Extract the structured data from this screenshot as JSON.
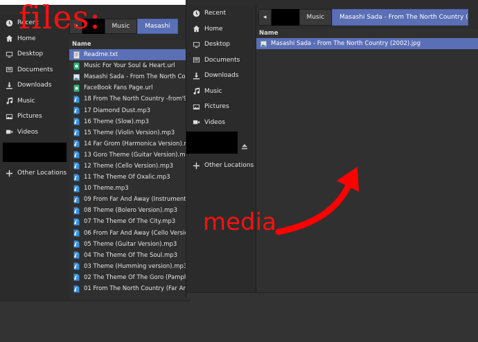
{
  "annotation": {
    "files_label": "files:",
    "media_label": "media",
    "arrow_color": "#ff0000"
  },
  "files_window": {
    "sidebar": [
      {
        "label": "Recent",
        "icon": "clock-icon"
      },
      {
        "label": "Home",
        "icon": "home-icon"
      },
      {
        "label": "Desktop",
        "icon": "desktop-icon"
      },
      {
        "label": "Documents",
        "icon": "documents-icon"
      },
      {
        "label": "Downloads",
        "icon": "downloads-icon"
      },
      {
        "label": "Music",
        "icon": "music-icon"
      },
      {
        "label": "Pictures",
        "icon": "pictures-icon"
      },
      {
        "label": "Videos",
        "icon": "videos-icon"
      },
      {
        "label": "Other Locations",
        "icon": "plus-icon"
      }
    ],
    "pathbar": [
      "Music",
      "Masashi"
    ],
    "column_header": "Name",
    "files": [
      {
        "name": "Readme.txt",
        "type": "text",
        "selected": true
      },
      {
        "name": "Music For Your Soul & Heart.url",
        "type": "url"
      },
      {
        "name": "Masashi Sada - From The North Cou",
        "type": "image"
      },
      {
        "name": "FaceBook Fans Page.url",
        "type": "url"
      },
      {
        "name": "18 From The North Country -from'9",
        "type": "audio"
      },
      {
        "name": "17 Diamond Dust.mp3",
        "type": "audio"
      },
      {
        "name": "16 Theme (Slow).mp3",
        "type": "audio"
      },
      {
        "name": "15 Theme (Violin Version).mp3",
        "type": "audio"
      },
      {
        "name": "14 Far Grom (Harmonica Version).mp",
        "type": "audio"
      },
      {
        "name": "13 Goro Theme (Guitar Version).mp",
        "type": "audio"
      },
      {
        "name": "12 Theme (Cello Version).mp3",
        "type": "audio"
      },
      {
        "name": "11 The Theme Of Oxalic.mp3",
        "type": "audio"
      },
      {
        "name": "10 Theme.mp3",
        "type": "audio"
      },
      {
        "name": "09 From Far And Away (Instrument",
        "type": "audio"
      },
      {
        "name": "08 Theme (Bolero Version).mp3",
        "type": "audio"
      },
      {
        "name": "07 The Theme Of The City.mp3",
        "type": "audio"
      },
      {
        "name": "06 From Far And Away (Cello Versio",
        "type": "audio"
      },
      {
        "name": "05 Theme (Guitar Version).mp3",
        "type": "audio"
      },
      {
        "name": "04 The Theme Of The Soul.mp3",
        "type": "audio"
      },
      {
        "name": "03 Theme (Humming version).mp3",
        "type": "audio"
      },
      {
        "name": "02 The Theme Of The Goro (Pamph",
        "type": "audio"
      },
      {
        "name": "01 From The North Country (Far Ar",
        "type": "audio"
      }
    ]
  },
  "media_window": {
    "sidebar": [
      {
        "label": "Recent",
        "icon": "clock-icon"
      },
      {
        "label": "Home",
        "icon": "home-icon"
      },
      {
        "label": "Desktop",
        "icon": "desktop-icon"
      },
      {
        "label": "Documents",
        "icon": "documents-icon"
      },
      {
        "label": "Downloads",
        "icon": "downloads-icon"
      },
      {
        "label": "Music",
        "icon": "music-icon"
      },
      {
        "label": "Pictures",
        "icon": "pictures-icon"
      },
      {
        "label": "Videos",
        "icon": "videos-icon"
      },
      {
        "label": "Other Locations",
        "icon": "plus-icon"
      }
    ],
    "pathbar": [
      "Music",
      "Masashi Sada - From The North Country (20"
    ],
    "column_header": "Name",
    "files": [
      {
        "name": "Masashi Sada - From The North Country (2002).jpg",
        "type": "image",
        "selected": true
      }
    ]
  },
  "colors": {
    "accent": "#5a6fb5",
    "audio_icon": "#3d8fd6",
    "url_icon": "#2fb37b"
  }
}
